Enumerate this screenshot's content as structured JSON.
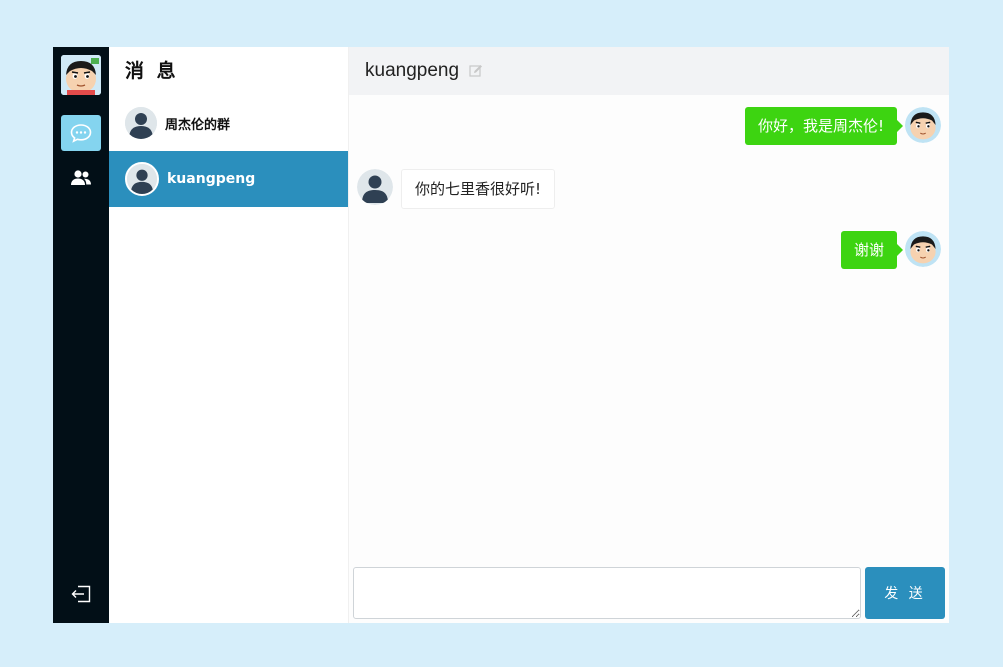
{
  "sidebar": {
    "nav": [
      {
        "icon": "chat-bubble-icon",
        "active": true
      },
      {
        "icon": "contacts-icon",
        "active": false
      }
    ],
    "logout_icon": "logout-icon"
  },
  "conversations": {
    "title": "消 息",
    "items": [
      {
        "name": "周杰伦的群",
        "selected": false
      },
      {
        "name": "kuangpeng",
        "selected": true
      }
    ]
  },
  "chat": {
    "peer_name": "kuangpeng",
    "messages": [
      {
        "direction": "out",
        "text": "你好，我是周杰伦!"
      },
      {
        "direction": "in",
        "text": "你的七里香很好听!"
      },
      {
        "direction": "out",
        "text": "谢谢"
      }
    ],
    "input_value": "",
    "send_label": "发 送"
  },
  "colors": {
    "page_bg": "#d6eefa",
    "rail_bg": "#020f17",
    "accent": "#2b8fbd",
    "bubble_out": "#3dd411"
  }
}
